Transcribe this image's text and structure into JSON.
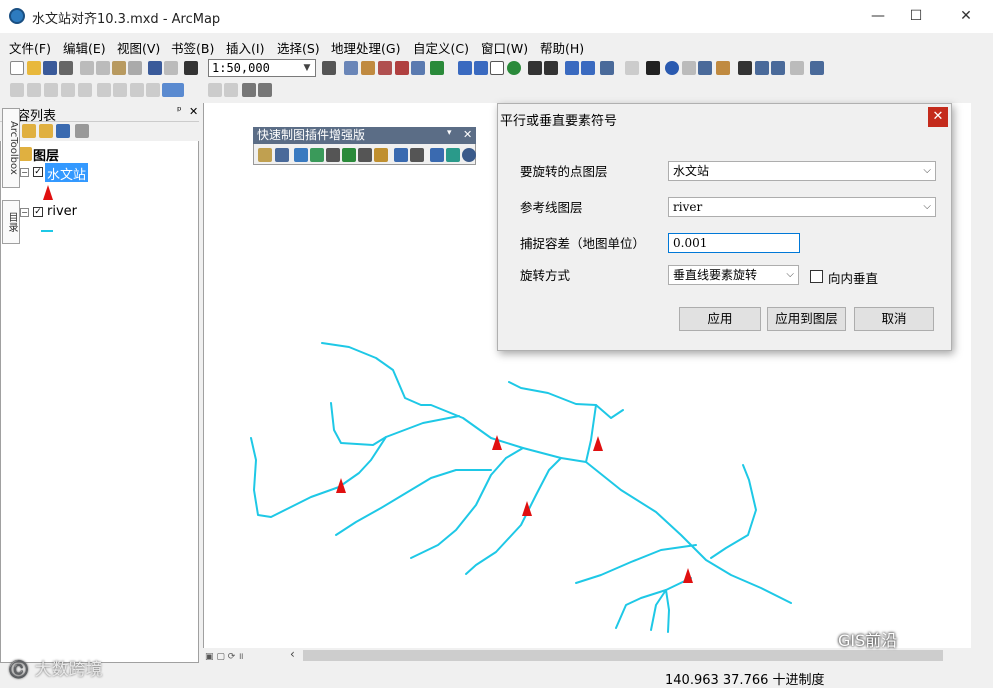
{
  "window": {
    "title": "水文站对齐10.3.mxd - ArcMap",
    "min": "—",
    "max": "☐",
    "close": "✕"
  },
  "menu": [
    "文件(F)",
    "编辑(E)",
    "视图(V)",
    "书签(B)",
    "插入(I)",
    "选择(S)",
    "地理处理(G)",
    "自定义(C)",
    "窗口(W)",
    "帮助(H)"
  ],
  "toolbar": {
    "scale": "1:50,000"
  },
  "toc": {
    "title": "内容列表",
    "pin": "ᵖ",
    "close": "✕",
    "root": "图层",
    "layers": [
      {
        "name": "水文站",
        "checked": "✓",
        "expand": "−"
      },
      {
        "name": "river",
        "checked": "✓",
        "expand": "−"
      }
    ]
  },
  "floatbar": {
    "title": "快速制图插件增强版"
  },
  "right_tabs": [
    "ArcToolbox",
    "目录"
  ],
  "dialog": {
    "title": "平行或垂直要素符号",
    "close": "✕",
    "point_layer_label": "要旋转的点图层",
    "point_layer_value": "水文站",
    "ref_layer_label": "参考线图层",
    "ref_layer_value": "river",
    "tolerance_label": "捕捉容差（地图单位）",
    "tolerance_value": "0.001",
    "rotate_label": "旋转方式",
    "rotate_value": "垂直线要素旋转",
    "inward_label": "向内垂直",
    "apply": "应用",
    "apply_layer": "应用到图层",
    "cancel": "取消"
  },
  "status": {
    "coords": "140.963  37.766 十进制度"
  },
  "watermarks": {
    "left": "©️ 大数跨境",
    "right": "GIS前沿"
  },
  "colors": {
    "river": "#1ec8e6",
    "station": "#e01010",
    "selection": "#3399ff"
  }
}
